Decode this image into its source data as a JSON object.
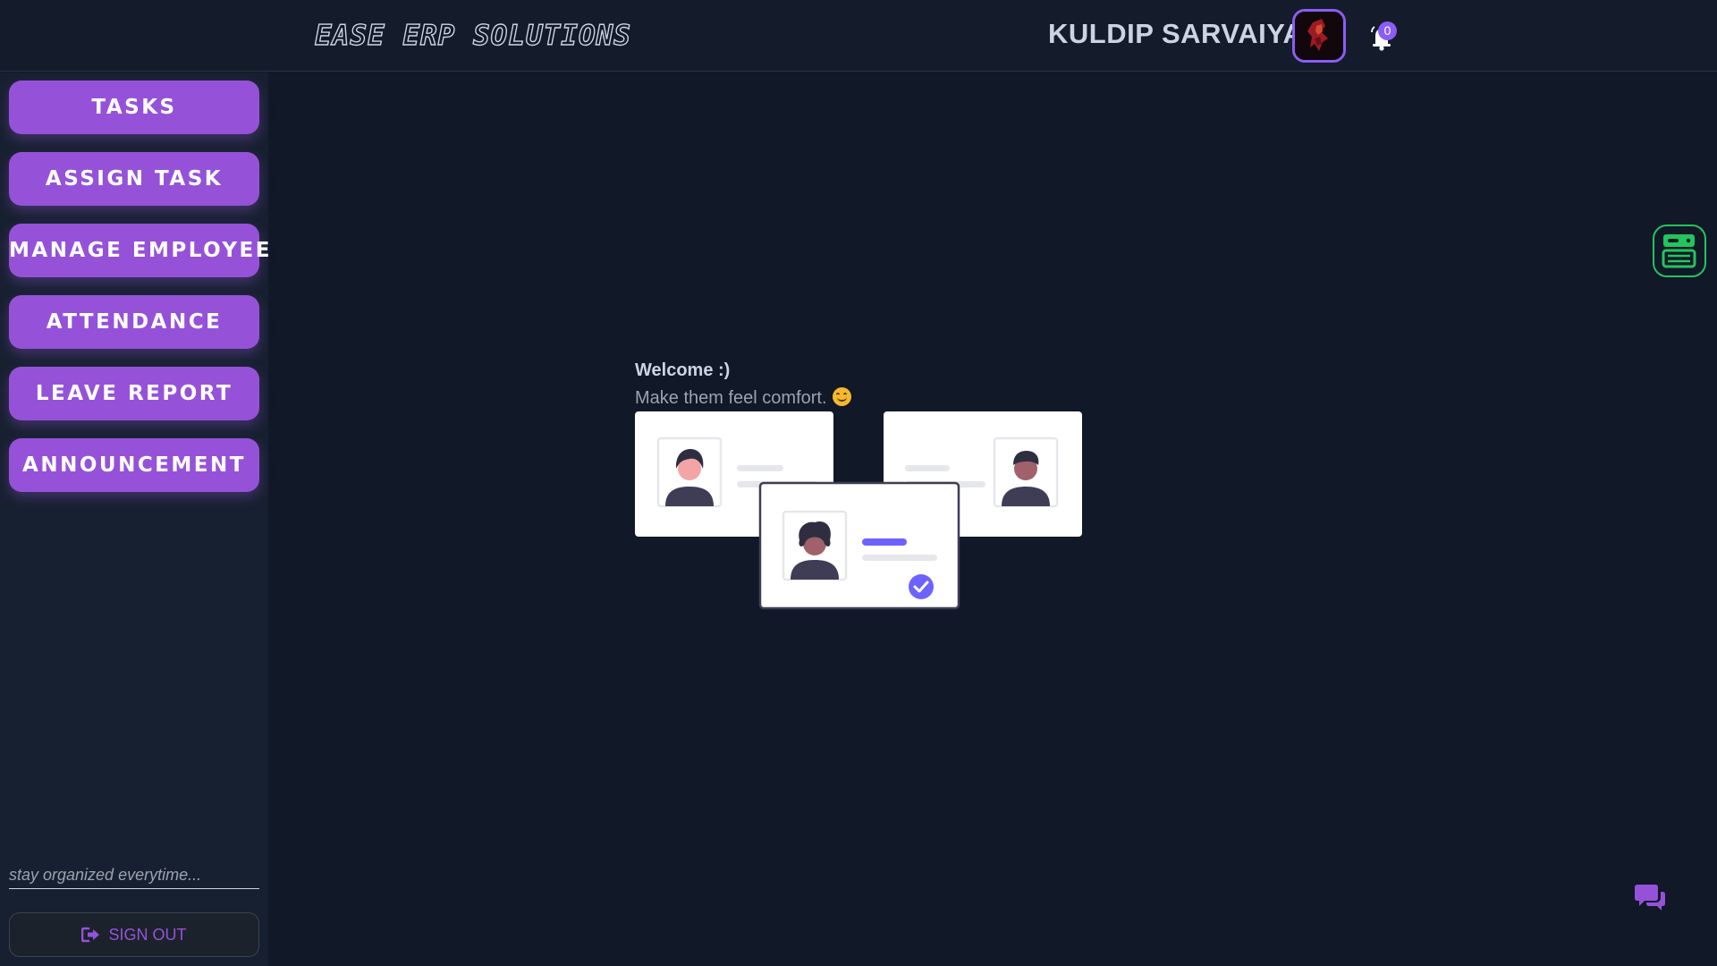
{
  "header": {
    "brand": "EASE ERP SOLUTIONS",
    "user_name": "KULDIP SARVAIYA",
    "notification_count": "0"
  },
  "sidebar": {
    "items": [
      {
        "label": "TASKS"
      },
      {
        "label": "ASSIGN TASK"
      },
      {
        "label": "MANAGE EMPLOYEE"
      },
      {
        "label": "ATTENDANCE"
      },
      {
        "label": "LEAVE REPORT"
      },
      {
        "label": "ANNOUNCEMENT"
      }
    ],
    "tagline": "stay organized everytime...",
    "signout_label": "SIGN OUT"
  },
  "main": {
    "welcome_title": "Welcome :)",
    "welcome_subtitle": "Make them feel comfort."
  },
  "colors": {
    "accent": "#9552d8",
    "background": "#111827",
    "sidebar": "#172030",
    "widget_green": "#22c55e"
  },
  "icons": [
    "bell-icon",
    "signout-icon",
    "smile-emoji-icon",
    "card-widget-icon",
    "chat-icon"
  ]
}
